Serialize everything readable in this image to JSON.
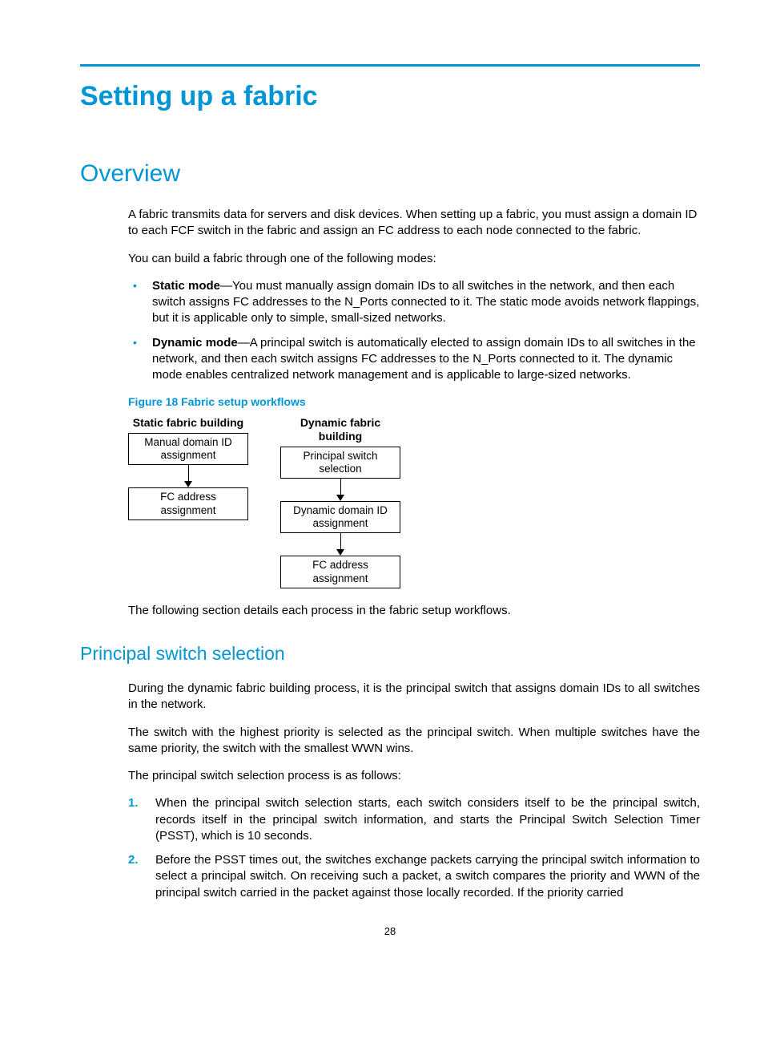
{
  "title": "Setting up a fabric",
  "overview": {
    "heading": "Overview",
    "p1": "A fabric transmits data for servers and disk devices. When setting up a fabric, you must assign a domain ID to each FCF switch in the fabric and assign an FC address to each node connected to the fabric.",
    "p2": "You can build a fabric through one of the following modes:",
    "bullets": [
      {
        "label": "Static mode",
        "text": "—You must manually assign domain IDs to all switches in the network, and then each switch assigns FC addresses to the N_Ports connected to it. The static mode avoids network flappings, but it is applicable only to simple, small-sized networks."
      },
      {
        "label": "Dynamic mode",
        "text": "—A principal switch is automatically elected to assign domain IDs to all switches in the network, and then each switch assigns FC addresses to the N_Ports connected to it. The dynamic mode enables centralized network management and is applicable to large-sized networks."
      }
    ],
    "figure_caption": "Figure 18 Fabric setup workflows",
    "diagram": {
      "left": {
        "title": "Static fabric building",
        "boxes": [
          "Manual domain ID assignment",
          "FC address assignment"
        ]
      },
      "right": {
        "title": "Dynamic fabric building",
        "boxes": [
          "Principal switch selection",
          "Dynamic domain ID assignment",
          "FC address assignment"
        ]
      }
    },
    "p3": "The following section details each process in the fabric setup workflows."
  },
  "principal": {
    "heading": "Principal switch selection",
    "p1": "During the dynamic fabric building process, it is the principal switch that assigns domain IDs to all switches in the network.",
    "p2": "The switch with the highest priority is selected as the principal switch. When multiple switches have the same priority, the switch with the smallest WWN wins.",
    "p3": "The principal switch selection process is as follows:",
    "steps": [
      "When the principal switch selection starts, each switch considers itself to be the principal switch, records itself in the principal switch information, and starts the Principal Switch Selection Timer (PSST), which is 10 seconds.",
      "Before the PSST times out, the switches exchange packets carrying the principal switch information to select a principal switch. On receiving such a packet, a switch compares the priority and WWN of the principal switch carried in the packet against those locally recorded. If the priority carried"
    ]
  },
  "page_number": "28"
}
